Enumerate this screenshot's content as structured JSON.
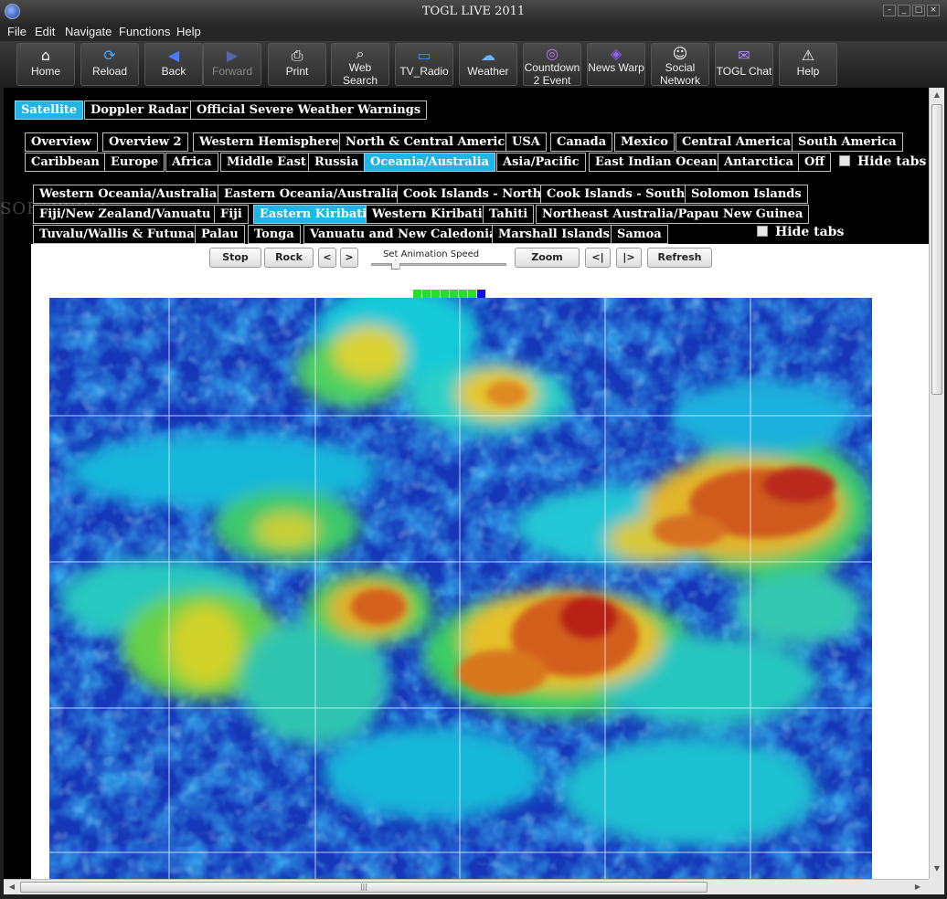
{
  "window": {
    "title": "TOGL LIVE 2011"
  },
  "menu": [
    "File",
    "Edit",
    "Navigate",
    "Functions",
    "Help"
  ],
  "toolbar": [
    {
      "label": "Home",
      "icon": "home-icon"
    },
    {
      "label": "Reload",
      "icon": "reload-icon"
    },
    {
      "label": "Back",
      "icon": "back-arrow-icon"
    },
    {
      "label": "Forward",
      "icon": "forward-arrow-icon"
    },
    {
      "label": "Print",
      "icon": "printer-icon"
    },
    {
      "label": "Web Search",
      "icon": "magnifier-icon"
    },
    {
      "label": "TV_Radio",
      "icon": "tv-icon"
    },
    {
      "label": "Weather",
      "icon": "weather-icon"
    },
    {
      "label": "Countdown 2 Event",
      "icon": "countdown-icon"
    },
    {
      "label": "News Warp",
      "icon": "news-icon"
    },
    {
      "label": "Social Network",
      "icon": "people-icon"
    },
    {
      "label": "TOGL Chat",
      "icon": "chat-icon"
    },
    {
      "label": "Help",
      "icon": "warning-icon"
    }
  ],
  "main_tabs": [
    "Satellite",
    "Doppler Radar",
    "Official Severe Weather Warnings"
  ],
  "region_tabs_row1": [
    "Overview",
    "Overview 2",
    "Western Hemisphere",
    "North & Central America",
    "USA",
    "Canada",
    "Mexico",
    "Central America",
    "South America"
  ],
  "region_tabs_row2": [
    "Caribbean",
    "Europe",
    "Africa",
    "Middle East",
    "Russia",
    "Oceania/Australia",
    "Asia/Pacific",
    "East Indian Ocean",
    "Antarctica",
    "Off"
  ],
  "sub_tabs_row1": [
    "Western Oceania/Australia",
    "Eastern Oceania/Australia",
    "Cook Islands - North",
    "Cook Islands - South",
    "Solomon Islands"
  ],
  "sub_tabs_row2": [
    "Fiji/New Zealand/Vanuatu",
    "Fiji",
    "Eastern Kiribati",
    "Western Kiribati",
    "Tahiti",
    "Northeast Australia/Papau New Guinea"
  ],
  "sub_tabs_row3": [
    "Tuvalu/Wallis & Futuna",
    "Palau",
    "Tonga",
    "Vanuatu and New Caledonia",
    "Marshall Islands",
    "Samoa"
  ],
  "hide_tabs_label": "Hide tabs",
  "controls": {
    "stop": "Stop",
    "rock": "Rock",
    "prev": "<",
    "next": ">",
    "speed_label": "Set Animation Speed",
    "zoom": "Zoom",
    "first": "<|",
    "last": "|>",
    "refresh": "Refresh"
  },
  "animation": {
    "frames_total": 8,
    "current_frame": 8,
    "speed_fraction": 0.18
  },
  "colors": {
    "active_tab": "#21b5e6",
    "frame_done": "#22e322",
    "frame_current": "#1010e0"
  },
  "watermark": "SOFTPEDIA"
}
